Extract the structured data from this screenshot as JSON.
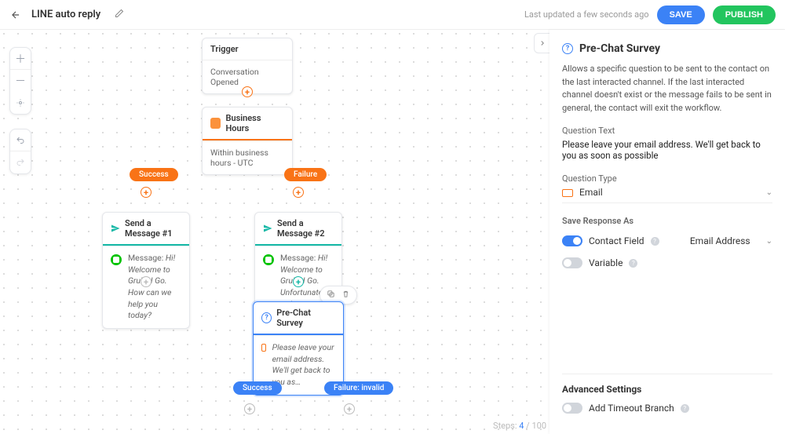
{
  "header": {
    "title": "LINE auto reply",
    "last_updated": "Last updated a few seconds ago",
    "save": "SAVE",
    "publish": "PUBLISH"
  },
  "canvas": {
    "trigger": {
      "title": "Trigger",
      "subtitle": "Conversation Opened"
    },
    "business_hours": {
      "title": "Business Hours",
      "subtitle": "Within business hours - UTC"
    },
    "branch_success": "Success",
    "branch_failure": "Failure",
    "msg1": {
      "title": "Send a Message #1",
      "prefix": "Message:",
      "body": "Hi! Welcome to Grub N Go. How can we help you today?"
    },
    "msg2": {
      "title": "Send a Message #2",
      "prefix": "Message:",
      "body": "Hi! Welcome to Grub N Go. Unfortunately we're not…"
    },
    "survey": {
      "title": "Pre-Chat Survey",
      "body": "Please leave your email address. We'll get back to you as…"
    },
    "survey_success": "Success",
    "survey_failure": "Failure: invalid",
    "steps_label": "Steps:",
    "steps_current": "4",
    "steps_total": "100"
  },
  "panel": {
    "title": "Pre-Chat Survey",
    "description": "Allows a specific question to be sent to the contact on the last interacted channel. If the last interacted channel doesn't exist or the message fails to be sent in general, the contact will exit the workflow.",
    "question_text_label": "Question Text",
    "question_text_value": "Please leave your email address. We'll get back to you as soon as possible",
    "question_type_label": "Question Type",
    "question_type_value": "Email",
    "save_response_label": "Save Response As",
    "contact_field_label": "Contact Field",
    "contact_field_value": "Email Address",
    "variable_label": "Variable",
    "advanced_label": "Advanced Settings",
    "timeout_label": "Add Timeout Branch"
  }
}
